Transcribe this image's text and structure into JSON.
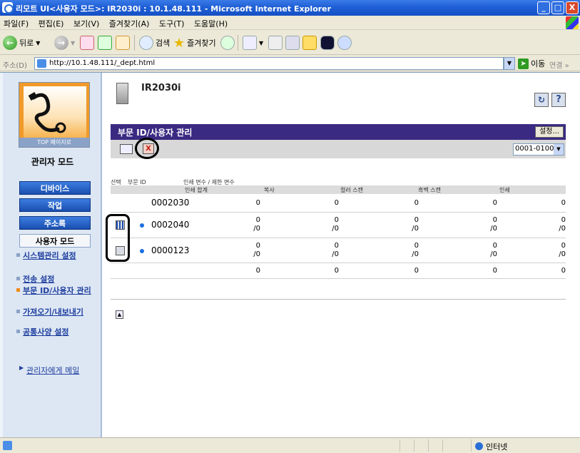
{
  "window": {
    "title": "리모트 UI<사용자 모드>: IR2030i : 10.1.48.111 - Microsoft Internet Explorer",
    "min": "_",
    "max": "□",
    "close": "X"
  },
  "menu": [
    "파일(F)",
    "편집(E)",
    "보기(V)",
    "즐겨찾기(A)",
    "도구(T)",
    "도움말(H)"
  ],
  "toolbar": {
    "back": "뒤로",
    "search": "검색",
    "favorites": "즐겨찾기"
  },
  "address": {
    "label": "주소(D)",
    "url": "http://10.1.48.111/_dept.html",
    "go": "이동",
    "links": "연결 »"
  },
  "sidebar": {
    "logo_caption": "TOP 페이지로",
    "mode_title": "관리자 모드",
    "buttons": [
      "디바이스",
      "작업",
      "주소록",
      "사용자 모드"
    ],
    "links": [
      "시스템관리 설정",
      "전송 설정",
      "부문 ID/사용자 관리",
      "가져오기/내보내기",
      "공통사양 설정"
    ],
    "mail": "관리자에게 메일"
  },
  "main": {
    "device_name": "IR2030i",
    "refresh_icon": "refresh-icon",
    "help_icon": "?",
    "section_title": "부문 ID/사용자 관리",
    "settings_button": "설정...",
    "range_select": "0001-0100",
    "delete_icon_text": "X",
    "header_row1": [
      "선택",
      "부문 ID",
      "인쇄 면수 / 제한 면수"
    ],
    "header_row2": [
      "인쇄 합계",
      "복사",
      "컬러 스캔",
      "흑백 스캔",
      "인쇄"
    ],
    "rows": [
      {
        "id": "0002030",
        "values": [
          "0",
          "0",
          "0",
          "0",
          "0"
        ],
        "limits": [
          "",
          "",
          "",
          "",
          ""
        ]
      },
      {
        "id": "0002040",
        "values": [
          "0",
          "0",
          "0",
          "0",
          "0"
        ],
        "limits": [
          "/0",
          "/0",
          "/0",
          "/0",
          "/0"
        ]
      },
      {
        "id": "0000123",
        "values": [
          "0",
          "0",
          "0",
          "0",
          "0"
        ],
        "limits": [
          "/0",
          "/0",
          "/0",
          "/0",
          "/0"
        ]
      },
      {
        "id": "",
        "values": [
          "0",
          "0",
          "0",
          "0",
          "0"
        ],
        "limits": [
          "",
          "",
          "",
          "",
          ""
        ]
      }
    ],
    "top_link": "▲"
  },
  "status": {
    "zone": "인터넷"
  }
}
